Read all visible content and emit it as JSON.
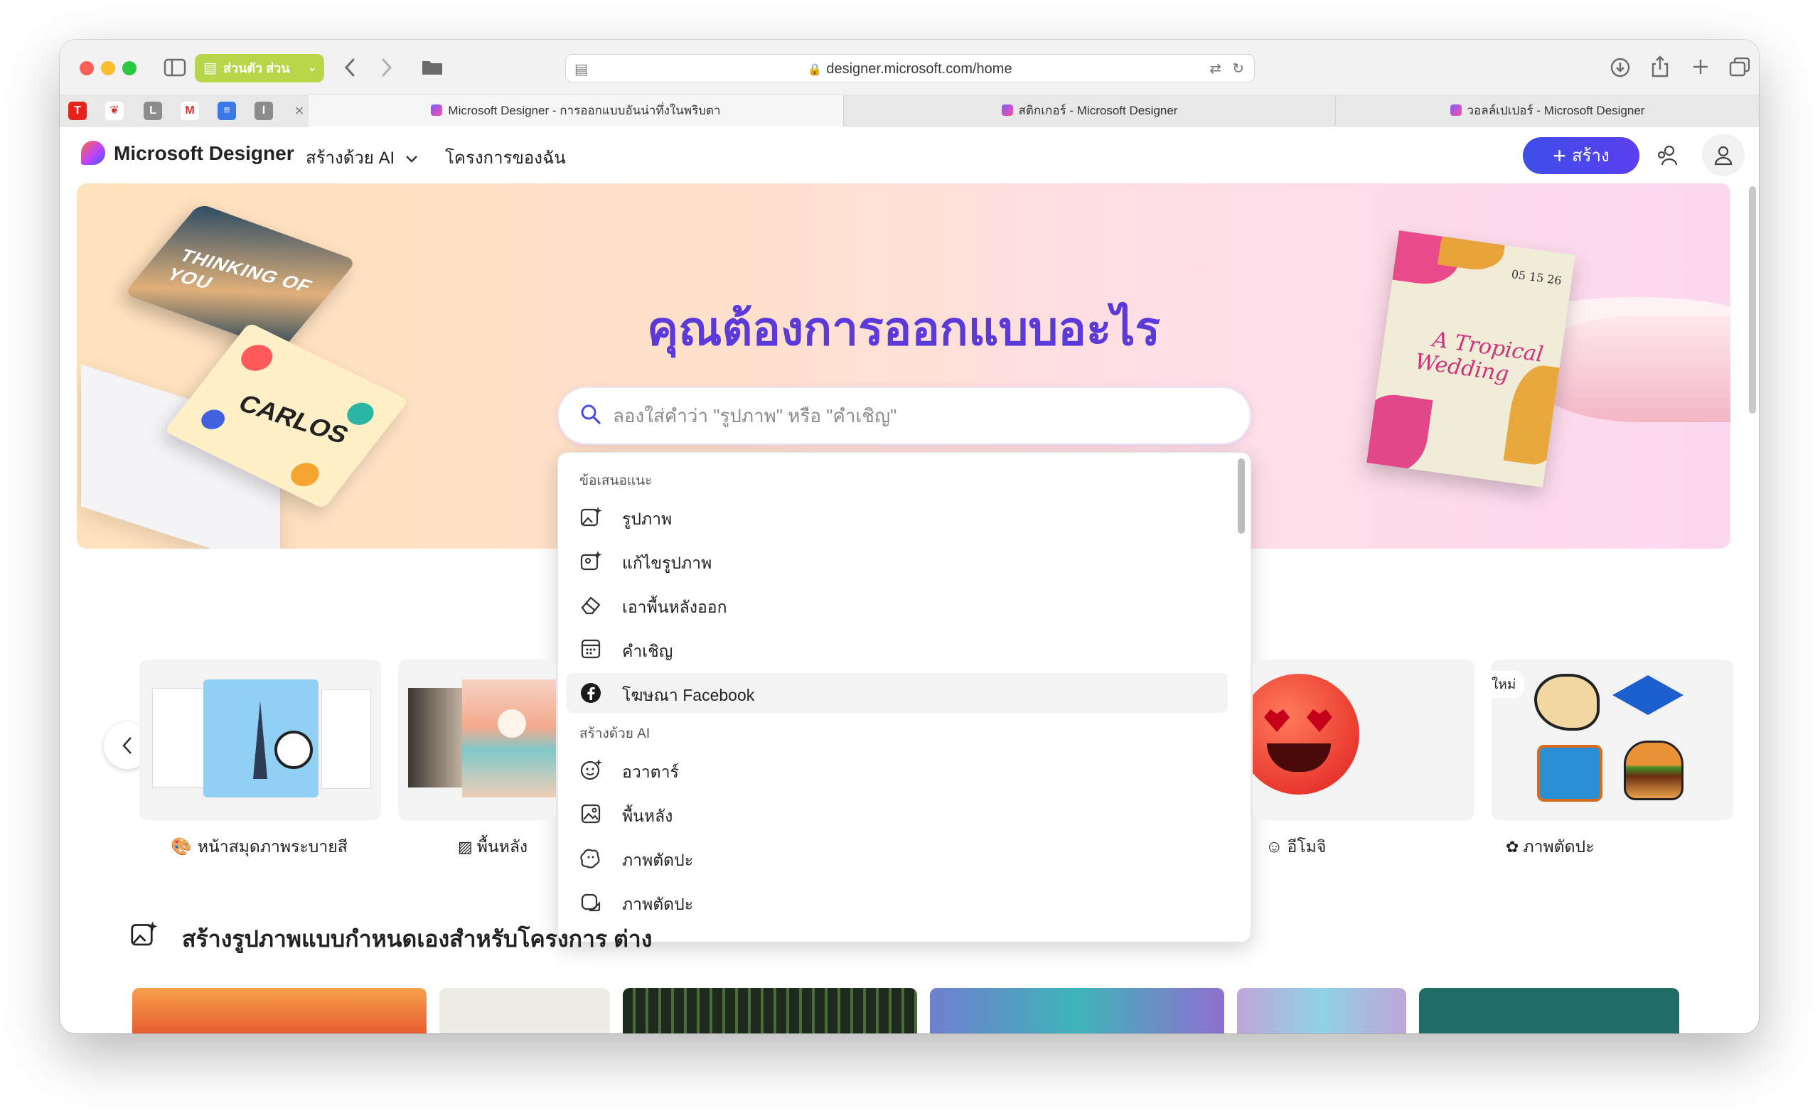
{
  "browser": {
    "tab_group_label": "ส่วนตัว ส่วน",
    "url": "designer.microsoft.com/home",
    "tabs": [
      {
        "title": "Microsoft Designer - การออกแบบอันน่าทึ่งในพริบตา"
      },
      {
        "title": "สติกเกอร์ - Microsoft Designer"
      },
      {
        "title": "วอลล์เปเปอร์ - Microsoft Designer"
      }
    ],
    "close_glyph": "×"
  },
  "app": {
    "brand": "Microsoft Designer",
    "nav": {
      "create_with_ai": "สร้างด้วย AI",
      "my_projects": "โครงการของฉัน"
    },
    "create_button": "สร้าง"
  },
  "hero": {
    "title": "คุณต้องการออกแบบอะไร",
    "card_text": {
      "thinking": "THINKING OF YOU",
      "carlos": "CARLOS",
      "wedding_line1": "A Tropical",
      "wedding_line2": "Wedding",
      "wedding_date": "05 15 26"
    }
  },
  "search": {
    "placeholder": "ลองใส่คำว่า \"รูปภาพ\" หรือ \"คำเชิญ\"",
    "value": ""
  },
  "dropdown": {
    "suggestions_heading": "ข้อเสนอแนะ",
    "suggestions": [
      {
        "label": "รูปภาพ",
        "icon": "image-sparkle-icon"
      },
      {
        "label": "แก้ไขรูปภาพ",
        "icon": "image-edit-icon"
      },
      {
        "label": "เอาพื้นหลังออก",
        "icon": "eraser-icon"
      },
      {
        "label": "คำเชิญ",
        "icon": "calendar-icon"
      },
      {
        "label": "โฆษณา Facebook",
        "icon": "facebook-icon"
      }
    ],
    "ai_heading": "สร้างด้วย AI",
    "ai_items": [
      {
        "label": "อวาตาร์",
        "icon": "avatar-sparkle-icon"
      },
      {
        "label": "พื้นหลัง",
        "icon": "background-image-icon"
      },
      {
        "label": "ภาพตัดปะ",
        "icon": "sticker-icon"
      },
      {
        "label": "ภาพตัดปะ",
        "icon": "sticker-alt-icon"
      }
    ]
  },
  "carousel": {
    "items": [
      {
        "label": "หน้าสมุดภาพระบายสี"
      },
      {
        "label": "พื้นหลัง"
      },
      {
        "label": "อีโมจิ"
      },
      {
        "label": "ภาพตัดปะ",
        "badge": "ใหม่"
      }
    ]
  },
  "section": {
    "title": "สร้างรูปภาพแบบกำหนดเองสำหรับโครงการ ต่าง"
  },
  "colors": {
    "accent": "#5a3ad8",
    "create_button": "#3d4ee8",
    "tab_group": "#b7d64a"
  }
}
